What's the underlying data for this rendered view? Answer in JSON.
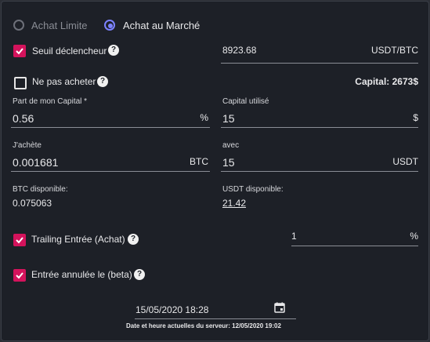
{
  "order_type": {
    "option_limit": "Achat Limite",
    "option_market": "Achat au Marché",
    "selected": "market"
  },
  "trigger": {
    "label": "Seuil déclencheur",
    "checked": true,
    "value": "8923.68",
    "unit": "USDT/BTC"
  },
  "no_buy": {
    "label": "Ne pas acheter",
    "checked": false
  },
  "capital": {
    "label": "Capital: 2673$"
  },
  "capital_share": {
    "label": "Part de mon Capital *",
    "value": "0.56",
    "unit": "%"
  },
  "capital_used": {
    "label": "Capital utilisé",
    "value": "15",
    "unit": "$"
  },
  "buy_amount": {
    "label": "J'achète",
    "value": "0.001681",
    "unit": "BTC"
  },
  "with_amount": {
    "label": "avec",
    "value": "15",
    "unit": "USDT"
  },
  "btc_available": {
    "label": "BTC disponible:",
    "value": "0.075063"
  },
  "usdt_available": {
    "label": "USDT disponible:",
    "value": "21.42"
  },
  "trailing": {
    "label": "Trailing Entrée (Achat)",
    "checked": true,
    "value": "1",
    "unit": "%"
  },
  "cancel_entry": {
    "label": "Entrée annulée le (beta)",
    "checked": true
  },
  "datetime": {
    "value": "15/05/2020 18:28",
    "server_note": "Date et heure actuelles du serveur: 12/05/2020 19:02"
  },
  "colors": {
    "accent": "#7c82ff",
    "checkbox": "#d4135c",
    "panel": "#1d2027"
  }
}
